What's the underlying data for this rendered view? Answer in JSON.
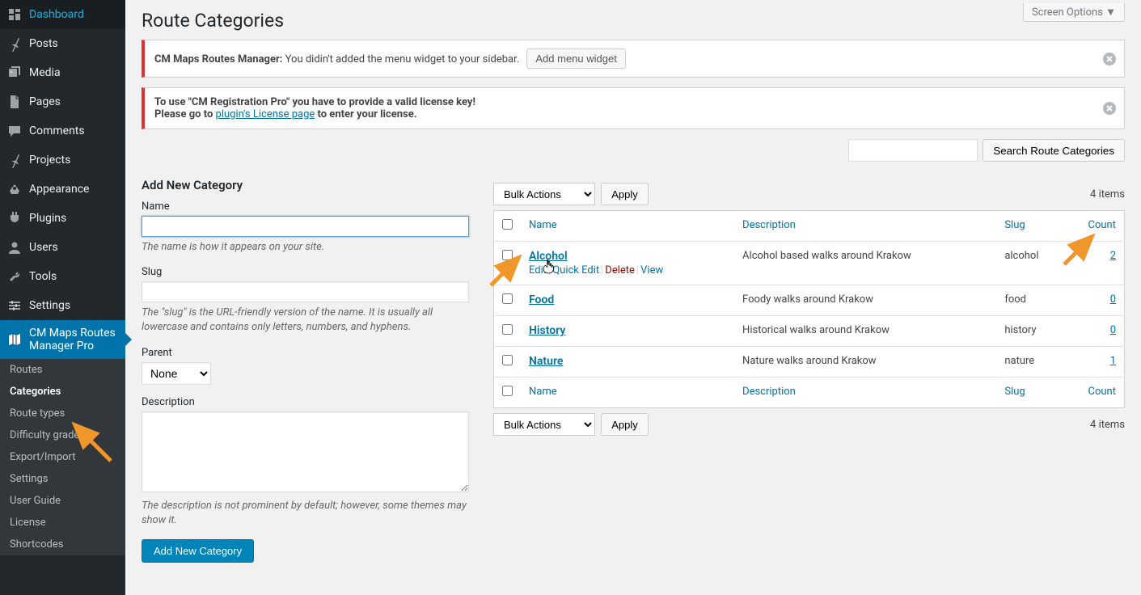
{
  "screen_options": "Screen Options ▼",
  "page_title": "Route Categories",
  "sidebar": {
    "items": [
      {
        "icon": "dashboard",
        "label": "Dashboard"
      },
      {
        "icon": "pin",
        "label": "Posts"
      },
      {
        "icon": "media",
        "label": "Media"
      },
      {
        "icon": "page",
        "label": "Pages"
      },
      {
        "icon": "comment",
        "label": "Comments"
      },
      {
        "icon": "pin",
        "label": "Projects"
      },
      {
        "icon": "appearance",
        "label": "Appearance"
      },
      {
        "icon": "plugin",
        "label": "Plugins"
      },
      {
        "icon": "users",
        "label": "Users"
      },
      {
        "icon": "tools",
        "label": "Tools"
      },
      {
        "icon": "settings",
        "label": "Settings"
      },
      {
        "icon": "map",
        "label": "CM Maps Routes Manager Pro",
        "active": true
      }
    ],
    "submenu": [
      {
        "label": "Routes"
      },
      {
        "label": "Categories",
        "current": true
      },
      {
        "label": "Route types"
      },
      {
        "label": "Difficulty grades"
      },
      {
        "label": "Export/Import"
      },
      {
        "label": "Settings"
      },
      {
        "label": "User Guide"
      },
      {
        "label": "License"
      },
      {
        "label": "Shortcodes"
      }
    ]
  },
  "notice1": {
    "strong": "CM Maps Routes Manager:",
    "text": " You didin't added the menu widget to your sidebar. ",
    "button": "Add menu widget"
  },
  "notice2": {
    "line1": "To use \"CM Registration Pro\" you have to provide a valid license key!",
    "line2a": "Please go to ",
    "link": "plugin's License page",
    "line2b": " to enter your license."
  },
  "form": {
    "heading": "Add New Category",
    "name_label": "Name",
    "name_hint": "The name is how it appears on your site.",
    "slug_label": "Slug",
    "slug_hint": "The \"slug\" is the URL-friendly version of the name. It is usually all lowercase and contains only letters, numbers, and hyphens.",
    "parent_label": "Parent",
    "parent_value": "None",
    "desc_label": "Description",
    "desc_hint": "The description is not prominent by default; however, some themes may show it.",
    "submit": "Add New Category"
  },
  "table": {
    "bulk_label": "Bulk Actions",
    "apply_label": "Apply",
    "search_btn": "Search Route Categories",
    "items_text": "4 items",
    "col_name": "Name",
    "col_desc": "Description",
    "col_slug": "Slug",
    "col_count": "Count",
    "actions": {
      "edit": "Edit",
      "quick": "Quick Edit",
      "delete": "Delete",
      "view": "View"
    },
    "rows": [
      {
        "name": "Alcohol",
        "desc": "Alcohol based walks around Krakow",
        "slug": "alcohol",
        "count": "2",
        "show_actions": true
      },
      {
        "name": "Food",
        "desc": "Foody walks around Krakow",
        "slug": "food",
        "count": "0"
      },
      {
        "name": "History",
        "desc": "Historical walks around Krakow",
        "slug": "history",
        "count": "0"
      },
      {
        "name": "Nature",
        "desc": "Nature walks around Krakow",
        "slug": "nature",
        "count": "1"
      }
    ]
  }
}
